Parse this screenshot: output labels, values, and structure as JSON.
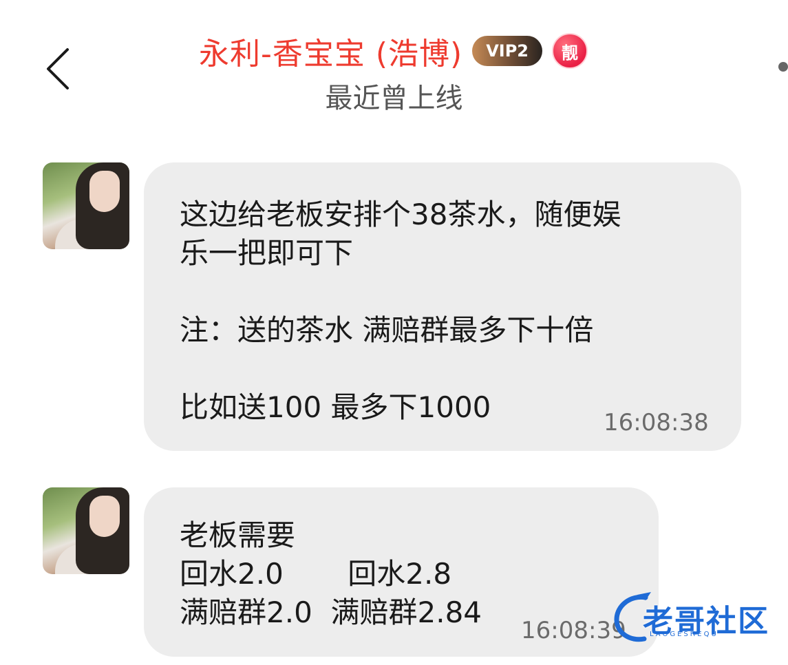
{
  "header": {
    "title": "永利-香宝宝 (浩博)",
    "vip_label": "VIP2",
    "hot_label": "靓",
    "status": "最近曾上线",
    "colors": {
      "title": "#ee3b2f",
      "hot_badge": "#ea2045"
    }
  },
  "messages": [
    {
      "text": "这边给老板安排个38茶水，随便娱\n乐一把即可下\n\n注：送的茶水 满赔群最多下十倍\n\n比如送100 最多下1000",
      "time": "16:08:38"
    },
    {
      "text": "老板需要\n回水2.0       回水2.8\n满赔群2.0  满赔群2.84",
      "time": "16:08:39"
    }
  ],
  "watermark": {
    "text": "老哥社区",
    "sub": "LAOGESHEQU"
  },
  "icons": [
    "back-chevron-icon",
    "more-dot-icon",
    "avatar",
    "watermark-logo"
  ]
}
